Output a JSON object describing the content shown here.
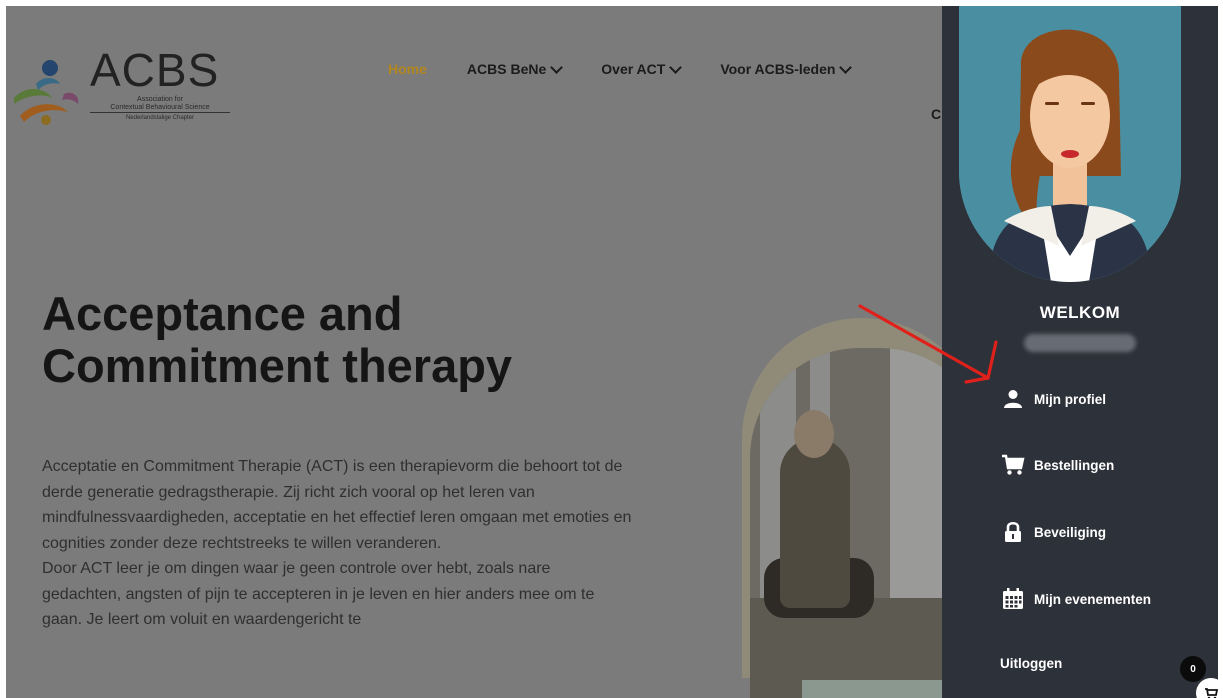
{
  "logo": {
    "title": "ACBS",
    "subtitle_line1": "Association for",
    "subtitle_line2": "Contextual Behavioural Science",
    "chapter": "Nederlandstalige Chapter"
  },
  "nav": {
    "items": [
      {
        "label": "Home",
        "active": true,
        "dropdown": false
      },
      {
        "label": "ACBS BeNe",
        "active": false,
        "dropdown": true
      },
      {
        "label": "Over ACT",
        "active": false,
        "dropdown": true
      },
      {
        "label": "Voor ACBS-leden",
        "active": false,
        "dropdown": true
      }
    ],
    "clipped_letter": "C"
  },
  "hero": {
    "title_line1": "Acceptance and",
    "title_line2": "Commitment therapy",
    "paragraph1": "Acceptatie en Commitment Therapie (ACT) is een therapievorm die behoort tot de derde generatie gedragstherapie. Zij richt zich vooral op het leren van mindfulnessvaardigheden, acceptatie en het effectief leren omgaan met emoties en cognities zonder deze rechtstreeks te willen veranderen.",
    "paragraph2": "Door ACT leer je om dingen waar je geen controle over hebt, zoals nare gedachten, angsten of pijn te accepteren in je leven en hier anders mee om te gaan. Je leert om voluit en waardengericht te"
  },
  "panel": {
    "welcome": "WELKOM",
    "menu": [
      {
        "label": "Mijn profiel",
        "icon": "user-icon"
      },
      {
        "label": "Bestellingen",
        "icon": "cart-icon"
      },
      {
        "label": "Beveiliging",
        "icon": "lock-icon"
      },
      {
        "label": "Mijn evenementen",
        "icon": "calendar-icon"
      }
    ],
    "logout": "Uitloggen"
  },
  "cart_badge": "0",
  "colors": {
    "active_nav": "#b2861f",
    "panel_bg": "#2d3139",
    "overlay_page": "#7b7b7b",
    "arrow": "#e0211b",
    "avatar_bg": "#4a8fa1"
  }
}
